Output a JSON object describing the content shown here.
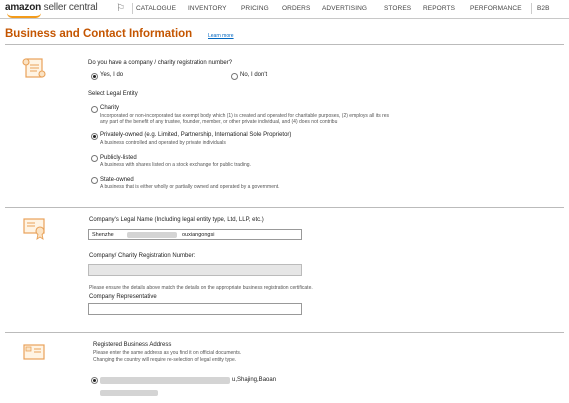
{
  "header": {
    "logo_text": "amazon",
    "logo_sub": "seller central",
    "nav": [
      "CATALOGUE",
      "INVENTORY",
      "PRICING",
      "ORDERS",
      "ADVERTISING",
      "STORES",
      "REPORTS",
      "PERFORMANCE",
      "B2B"
    ]
  },
  "page": {
    "title": "Business and Contact Information",
    "learn_more": "Learn more"
  },
  "registration": {
    "question": "Do you have a company / charity registration number?",
    "yes_label": "Yes, I do",
    "no_label": "No, I don't",
    "selected": "yes"
  },
  "legal_entity": {
    "heading": "Select Legal Entity",
    "options": [
      {
        "label": "Charity",
        "desc1": "Incorporated or non-incorporated tax exempt body which (1) is created and operated for charitable purposes, (2) employs all its res",
        "desc2": "any part of the benefit of any trustee, founder, member, or other private individual, and (4) does not contribu",
        "selected": false
      },
      {
        "label": "Privately-owned (e.g. Limited, Partnership, International Sole Proprietor)",
        "desc1": "A business controlled and operated by private individuals",
        "desc2": "",
        "selected": true
      },
      {
        "label": "Publicly-listed",
        "desc1": "A business with shares listed on a stock exchange for public trading.",
        "desc2": "",
        "selected": false
      },
      {
        "label": "State-owned",
        "desc1": "A business that is either wholly or partially owned and operated by a government.",
        "desc2": "",
        "selected": false
      }
    ]
  },
  "company": {
    "legal_name_label": "Company's Legal Name (Including legal entity type, Ltd, LLP, etc.)",
    "legal_name_start": "Shenzhe",
    "legal_name_end": "ouxiangongsi",
    "reg_number_label": "Company/ Charity Registration Number:",
    "note": "Please ensure the details above match the details on the appropriate business registration certificate.",
    "rep_label": "Company Representative"
  },
  "address": {
    "heading": "Registered Business Address",
    "note1": "Please enter the same address as you find it on official documents.",
    "note2": "Changing the country will require re-selection of legal entity type.",
    "selected_address_end": "u,Shajing,Baoan"
  }
}
